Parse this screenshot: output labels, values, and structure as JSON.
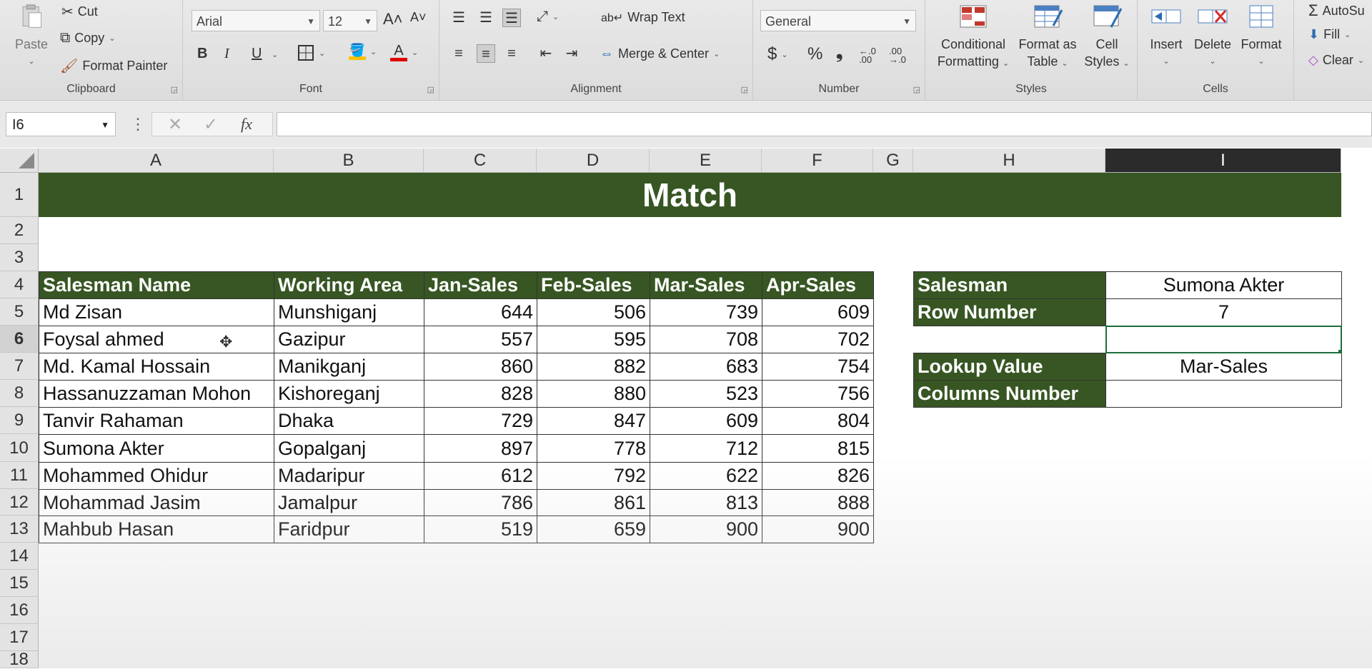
{
  "ribbon": {
    "clipboard": {
      "paste": "Paste",
      "cut": "Cut",
      "copy": "Copy",
      "format_painter": "Format Painter",
      "label": "Clipboard"
    },
    "font": {
      "name": "Arial",
      "size": "12",
      "grow": "A˄",
      "shrink": "A˅",
      "bold": "B",
      "italic": "I",
      "underline": "U",
      "label": "Font",
      "fill_color": "#ffc000",
      "font_color": "#e00000"
    },
    "alignment": {
      "wrap_text": "Wrap Text",
      "merge_center": "Merge & Center",
      "label": "Alignment"
    },
    "number": {
      "format": "General",
      "currency": "$",
      "percent": "%",
      "comma": "ங",
      "label": "Number"
    },
    "styles": {
      "conditional_1": "Conditional",
      "conditional_2": "Formatting",
      "format_as_1": "Format as",
      "format_as_2": "Table",
      "cell_styles_1": "Cell",
      "cell_styles_2": "Styles",
      "label": "Styles"
    },
    "cells": {
      "insert": "Insert",
      "delete": "Delete",
      "format": "Format",
      "label": "Cells"
    },
    "editing": {
      "autosum": "AutoSu",
      "fill": "Fill",
      "clear": "Clear"
    }
  },
  "formula_bar": {
    "name_box": "I6",
    "fx": "fx",
    "formula": ""
  },
  "columns": [
    "A",
    "B",
    "C",
    "D",
    "E",
    "F",
    "G",
    "H",
    "I"
  ],
  "rows": [
    "1",
    "2",
    "3",
    "4",
    "5",
    "6",
    "7",
    "8",
    "9",
    "10",
    "11",
    "12",
    "13",
    "14",
    "15",
    "16",
    "17",
    "18"
  ],
  "sheet": {
    "title": "Match",
    "headers": [
      "Salesman Name",
      "Working Area",
      "Jan-Sales",
      "Feb-Sales",
      "Mar-Sales",
      "Apr-Sales"
    ],
    "data": [
      [
        "Md Zisan",
        "Munshiganj",
        "644",
        "506",
        "739",
        "609"
      ],
      [
        "Foysal ahmed",
        "Gazipur",
        "557",
        "595",
        "708",
        "702"
      ],
      [
        "Md. Kamal Hossain",
        "Manikganj",
        "860",
        "882",
        "683",
        "754"
      ],
      [
        "Hassanuzzaman Mohon",
        "Kishoreganj",
        "828",
        "880",
        "523",
        "756"
      ],
      [
        "Tanvir Rahaman",
        "Dhaka",
        "729",
        "847",
        "609",
        "804"
      ],
      [
        "Sumona Akter",
        "Gopalganj",
        "897",
        "778",
        "712",
        "815"
      ],
      [
        "Mohammed Ohidur",
        "Madaripur",
        "612",
        "792",
        "622",
        "826"
      ],
      [
        "Mohammad Jasim",
        "Jamalpur",
        "786",
        "861",
        "813",
        "888"
      ],
      [
        "Mahbub Hasan",
        "Faridpur",
        "519",
        "659",
        "900",
        "900"
      ]
    ],
    "lookup": {
      "salesman_label": "Salesman",
      "salesman_value": "Sumona Akter",
      "row_number_label": "Row Number",
      "row_number_value": "7",
      "lookup_value_label": "Lookup Value",
      "lookup_value_value": "Mar-Sales",
      "columns_number_label": "Columns Number",
      "columns_number_value": ""
    }
  },
  "colors": {
    "header_green": "#375623",
    "active_cell_border": "#1e6e3b"
  }
}
